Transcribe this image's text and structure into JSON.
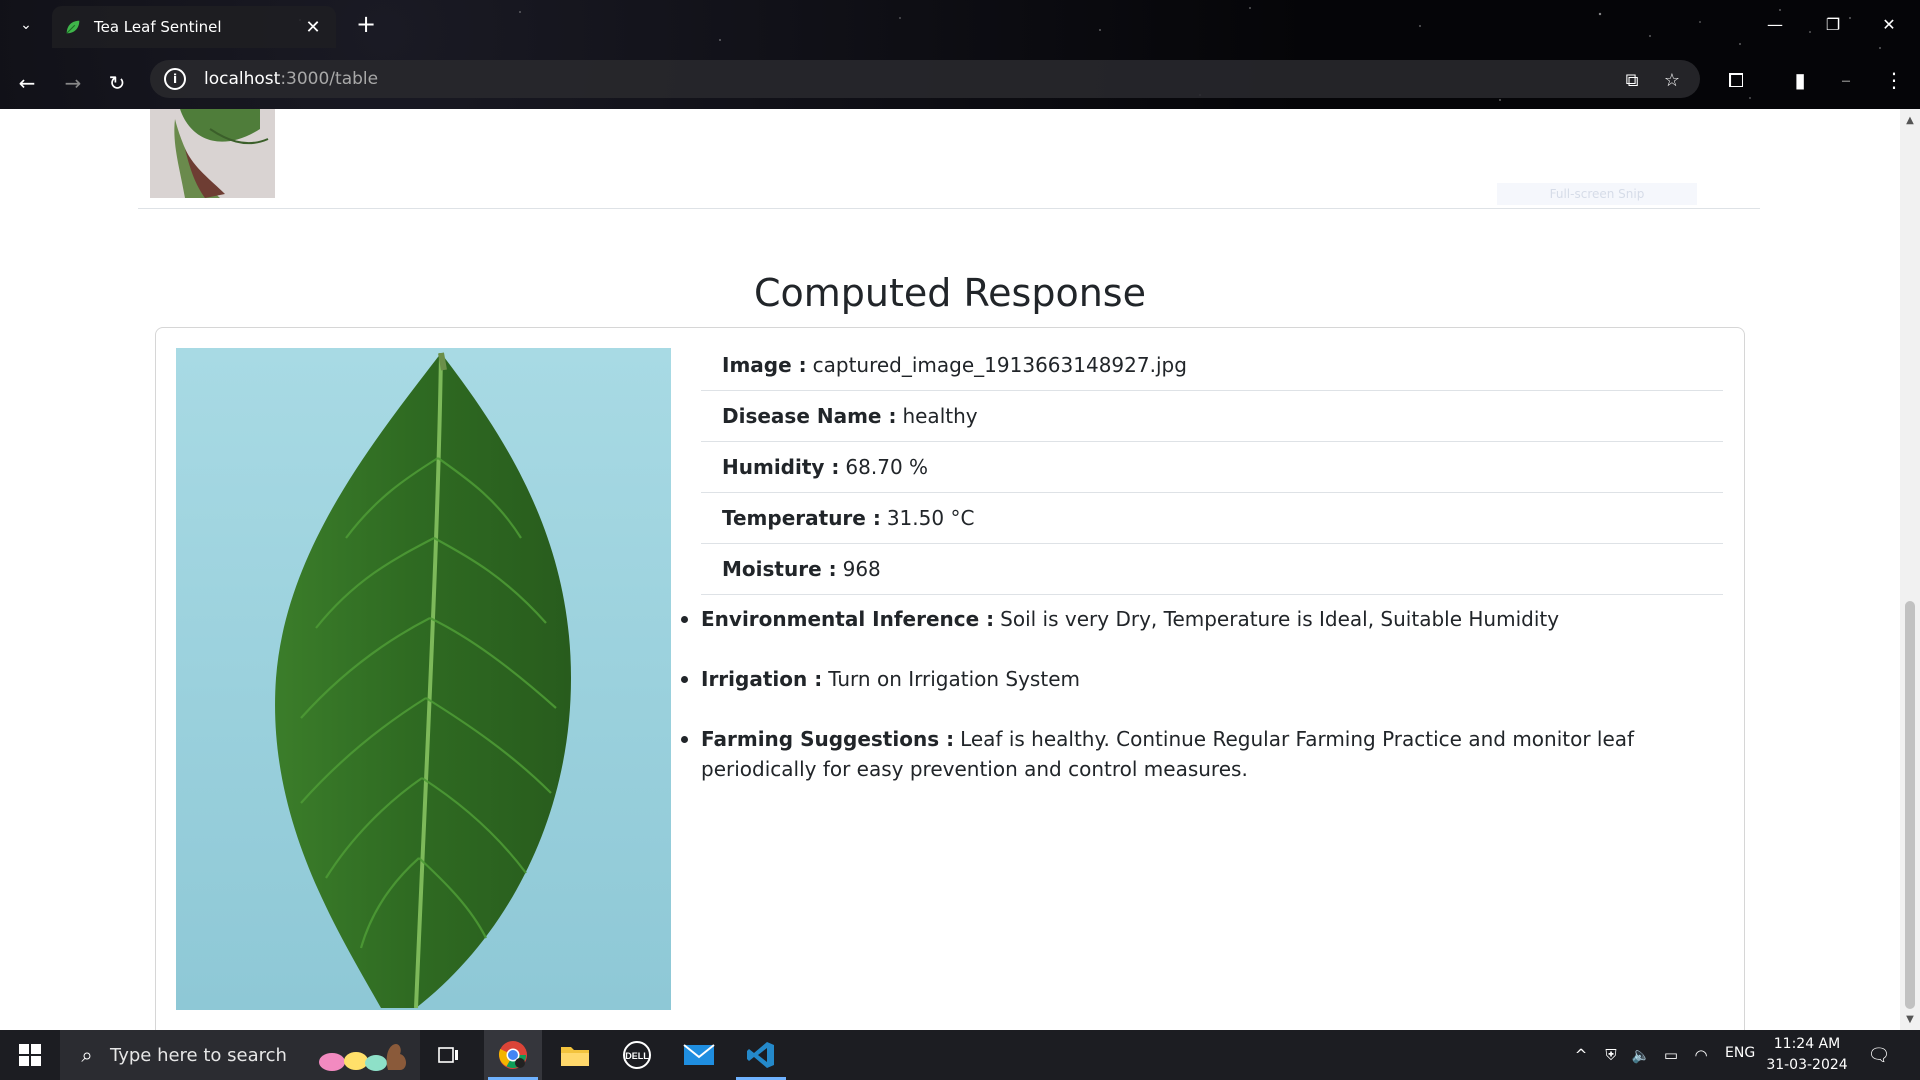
{
  "browser": {
    "tab_title": "Tea Leaf Sentinel",
    "url_host": "localhost",
    "url_rest": ":3000/table"
  },
  "page": {
    "snip_hint": "Full-screen Snip",
    "section_title": "Computed Response",
    "details": [
      {
        "label": "Image :",
        "value": "captured_image_1913663148927.jpg"
      },
      {
        "label": "Disease Name :",
        "value": "healthy"
      },
      {
        "label": "Humidity :",
        "value": "68.70 %"
      },
      {
        "label": "Temperature :",
        "value": "31.50 °C"
      },
      {
        "label": "Moisture :",
        "value": "968"
      }
    ],
    "inferences": [
      {
        "label": "Environmental Inference :",
        "value": "Soil is very Dry, Temperature is Ideal, Suitable Humidity"
      },
      {
        "label": "Irrigation :",
        "value": "Turn on Irrigation System"
      },
      {
        "label": "Farming Suggestions :",
        "value": "Leaf is healthy. Continue Regular Farming Practice and monitor leaf periodically for easy prevention and control measures."
      }
    ]
  },
  "taskbar": {
    "search_placeholder": "Type here to search",
    "language": "ENG",
    "time": "11:24 AM",
    "date": "31-03-2024"
  },
  "colors": {
    "leaf_dark": "#2f6b22",
    "leaf_light": "#4d9a35",
    "image_bg": "#9fd3de",
    "accent_blue": "#6fb2ff"
  }
}
